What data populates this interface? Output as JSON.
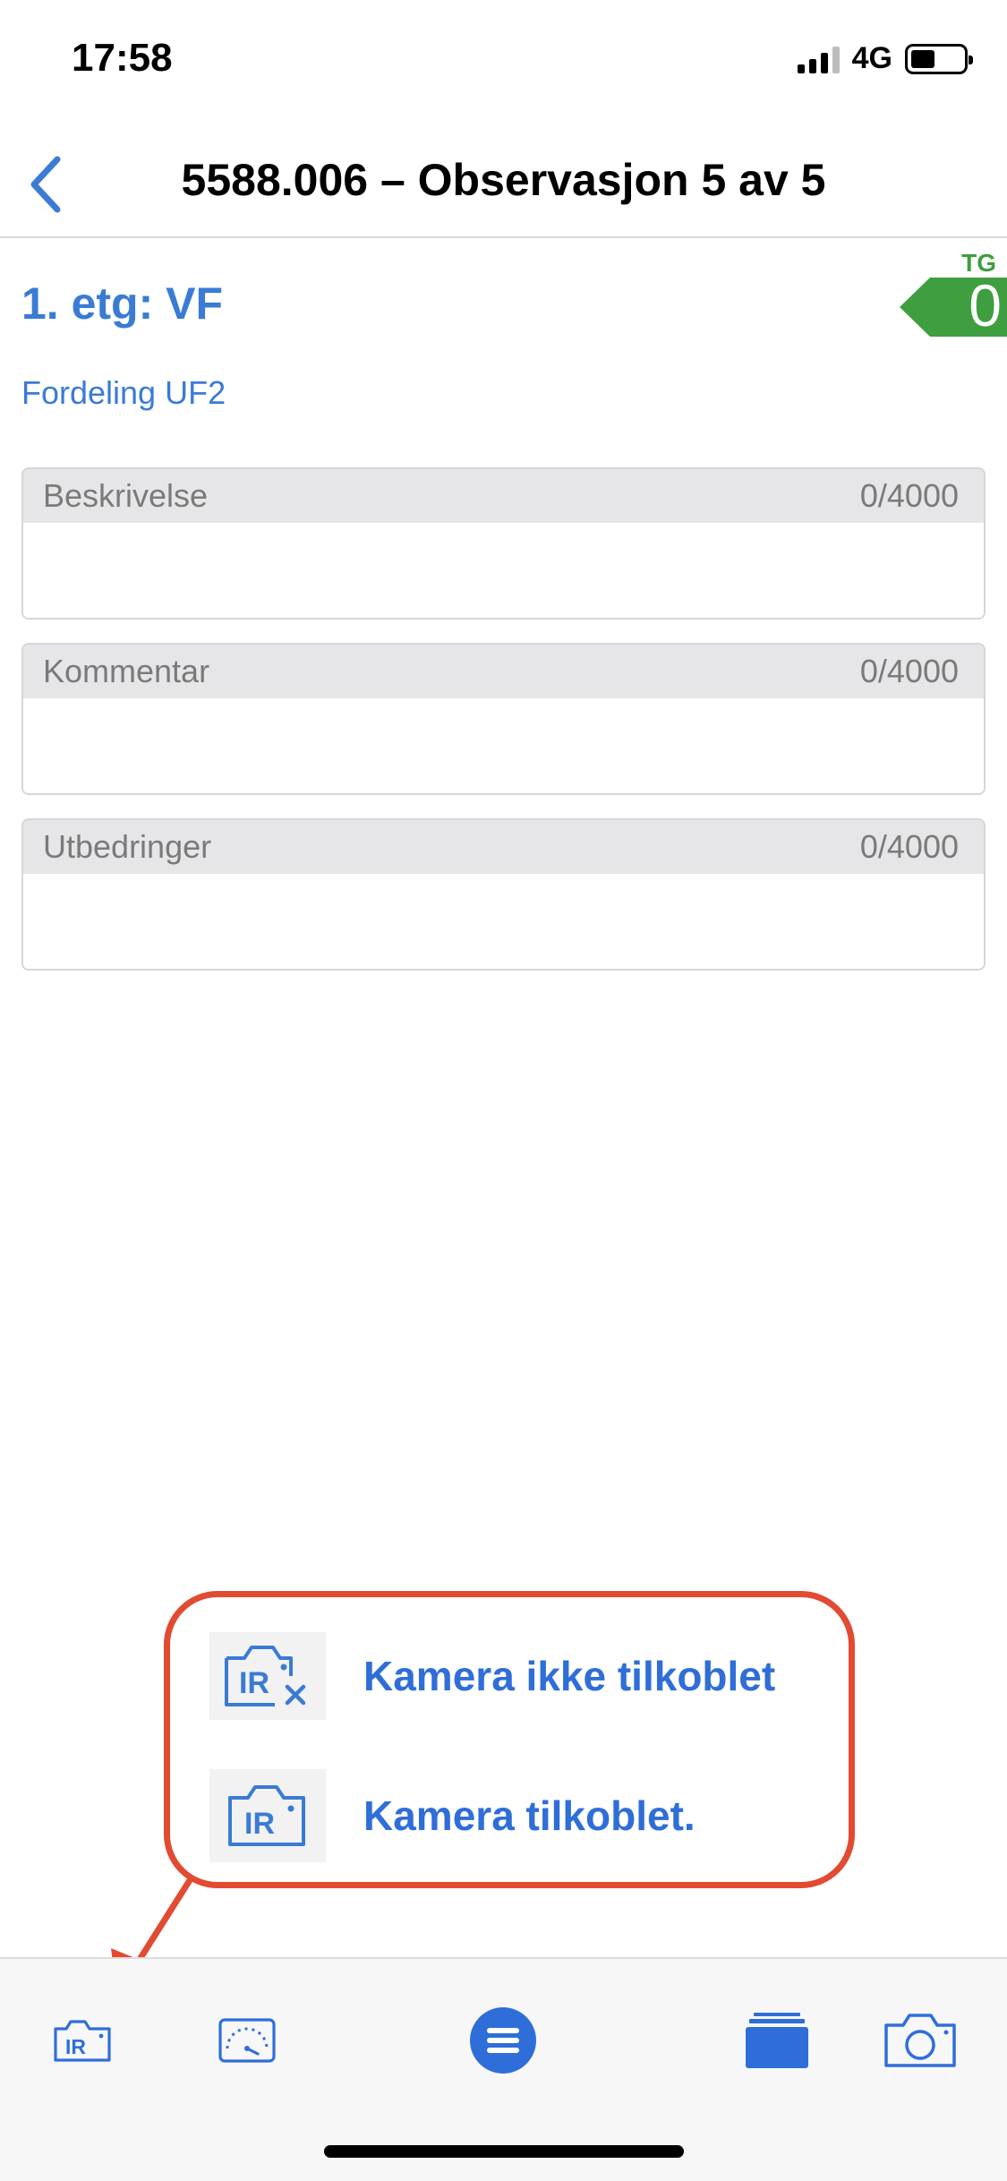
{
  "status_bar": {
    "time": "17:58",
    "network": "4G"
  },
  "header": {
    "title": "5588.006 – Observasjon 5 av 5"
  },
  "location": {
    "title": "1. etg: VF",
    "subtitle": "Fordeling UF2"
  },
  "condition": {
    "label": "TG",
    "value": "0",
    "color": "#3f9e3f"
  },
  "fields": [
    {
      "label": "Beskrivelse",
      "count": "0/4000",
      "value": ""
    },
    {
      "label": "Kommentar",
      "count": "0/4000",
      "value": ""
    },
    {
      "label": "Utbedringer",
      "count": "0/4000",
      "value": ""
    }
  ],
  "callout": {
    "items": [
      {
        "icon": "ir-camera-disconnected-icon",
        "label": "Kamera ikke tilkoblet"
      },
      {
        "icon": "ir-camera-connected-icon",
        "label": "Kamera tilkoblet."
      }
    ],
    "border_color": "#e24a32"
  },
  "toolbar": {
    "items": [
      {
        "icon": "ir-camera-icon"
      },
      {
        "icon": "gauge-icon"
      },
      {
        "icon": "menu-icon"
      },
      {
        "icon": "layers-icon"
      },
      {
        "icon": "camera-icon"
      }
    ],
    "accent": "#2f6ed8"
  },
  "icon_text": {
    "ir": "IR"
  }
}
